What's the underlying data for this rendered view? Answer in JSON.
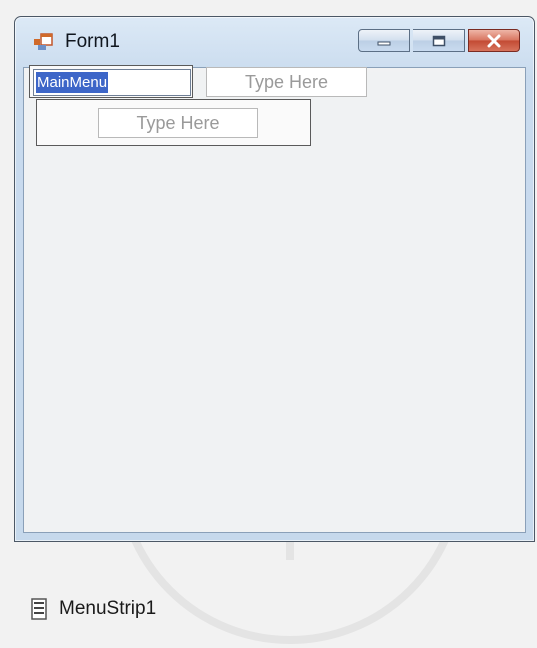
{
  "window": {
    "title": "Form1",
    "controls": {
      "minimize": "minimize",
      "maximize": "maximize",
      "close": "close"
    }
  },
  "menu_strip": {
    "main_item_label": "MainMenu",
    "top_placeholder": "Type Here",
    "sub_placeholder": "Type Here"
  },
  "tray": {
    "component_label": "MenuStrip1",
    "component_icon": "menustrip-icon"
  },
  "colors": {
    "selection": "#3d66c8",
    "close_button": "#c24a33",
    "titlebar": "#dce9f6"
  }
}
